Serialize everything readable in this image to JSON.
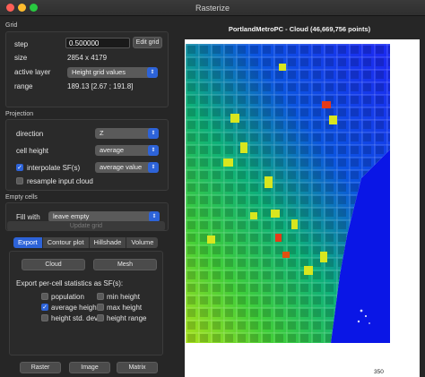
{
  "window": {
    "title": "Rasterize"
  },
  "grid": {
    "title": "Grid",
    "step_label": "step",
    "step_value": "0.500000",
    "edit_grid_label": "Edit grid",
    "size_label": "size",
    "size_value": "2854 x 4179",
    "active_layer_label": "active layer",
    "active_layer_value": "Height grid values",
    "range_label": "range",
    "range_value": "189.13 [2.67 ; 191.8]"
  },
  "projection": {
    "title": "Projection",
    "direction_label": "direction",
    "direction_value": "Z",
    "cell_height_label": "cell height",
    "cell_height_value": "average",
    "interpolate_label": "interpolate SF(s)",
    "interpolate_checked": true,
    "interpolate_value": "average value",
    "resample_label": "resample input cloud",
    "resample_checked": false
  },
  "empty_cells": {
    "title": "Empty cells",
    "fill_with_label": "Fill with",
    "fill_with_value": "leave empty"
  },
  "update_grid_label": "Update grid",
  "tabs": [
    "Export",
    "Contour plot",
    "Hillshade",
    "Volume"
  ],
  "export": {
    "cloud_label": "Cloud",
    "mesh_label": "Mesh",
    "per_cell_title": "Export per-cell statistics as SF(s):",
    "stats": [
      {
        "label": "population",
        "checked": false
      },
      {
        "label": "min height",
        "checked": false
      },
      {
        "label": "average height",
        "checked": true
      },
      {
        "label": "max height",
        "checked": false
      },
      {
        "label": "height std. dev.",
        "checked": false
      },
      {
        "label": "height range",
        "checked": false
      }
    ],
    "raster_label": "Raster",
    "image_label": "Image",
    "matrix_label": "Matrix"
  },
  "view": {
    "title": "PortlandMetroPC - Cloud (46,669,756 points)",
    "scale_value": "350"
  },
  "colors": {
    "accent": "#2d63d8",
    "low": "#1a2cf0",
    "mid": "#10c060",
    "high": "#d6e61a",
    "peak": "#e03020"
  }
}
